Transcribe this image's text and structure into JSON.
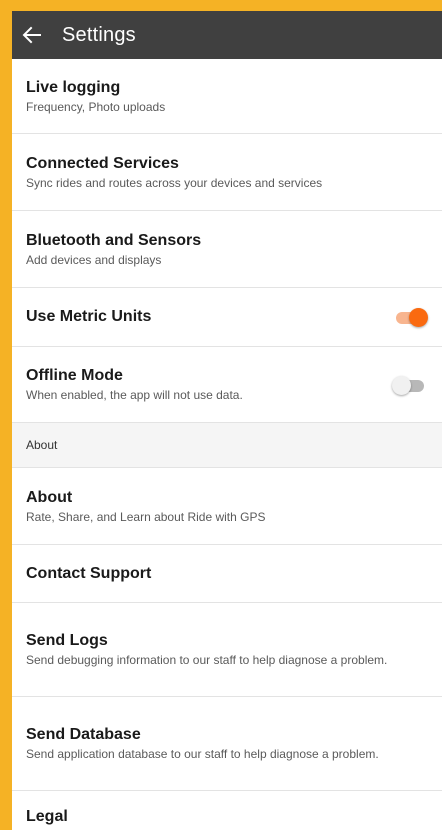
{
  "header": {
    "title": "Settings",
    "back_icon": "arrow-left-icon"
  },
  "items": {
    "live_logging": {
      "title": "Live logging",
      "subtitle": "Frequency, Photo uploads"
    },
    "connected_services": {
      "title": "Connected Services",
      "subtitle": "Sync rides and routes across your devices and services"
    },
    "bluetooth": {
      "title": "Bluetooth and Sensors",
      "subtitle": "Add devices and displays"
    },
    "metric_units": {
      "title": "Use Metric Units",
      "enabled": true
    },
    "offline_mode": {
      "title": "Offline Mode",
      "subtitle": "When enabled, the app will not use data.",
      "enabled": false
    },
    "about_section": {
      "label": "About"
    },
    "about": {
      "title": "About",
      "subtitle": "Rate, Share, and Learn about Ride with GPS"
    },
    "contact_support": {
      "title": "Contact Support"
    },
    "send_logs": {
      "title": "Send Logs",
      "subtitle": "Send debugging information to our staff to help diagnose a problem."
    },
    "send_database": {
      "title": "Send Database",
      "subtitle": "Send application database to our staff to help diagnose a problem."
    },
    "legal": {
      "title": "Legal"
    }
  },
  "colors": {
    "frame": "#f5b225",
    "appbar": "#404040",
    "accent": "#fa6a10"
  }
}
